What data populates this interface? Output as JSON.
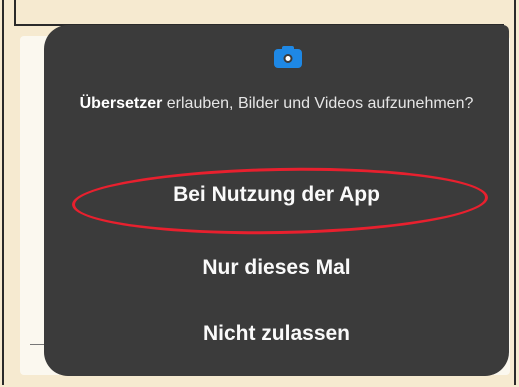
{
  "dialog": {
    "icon": "camera-icon",
    "app_name": "Übersetzer",
    "question_rest": " erlauben, Bilder und Videos aufzunehmen?",
    "options": [
      "Bei Nutzung der App",
      "Nur dieses Mal",
      "Nicht zulassen"
    ]
  },
  "colors": {
    "dialog_bg": "#3b3b3b",
    "accent": "#1e88e5",
    "highlight": "#e8202e",
    "page_bg": "#f6ead0"
  }
}
